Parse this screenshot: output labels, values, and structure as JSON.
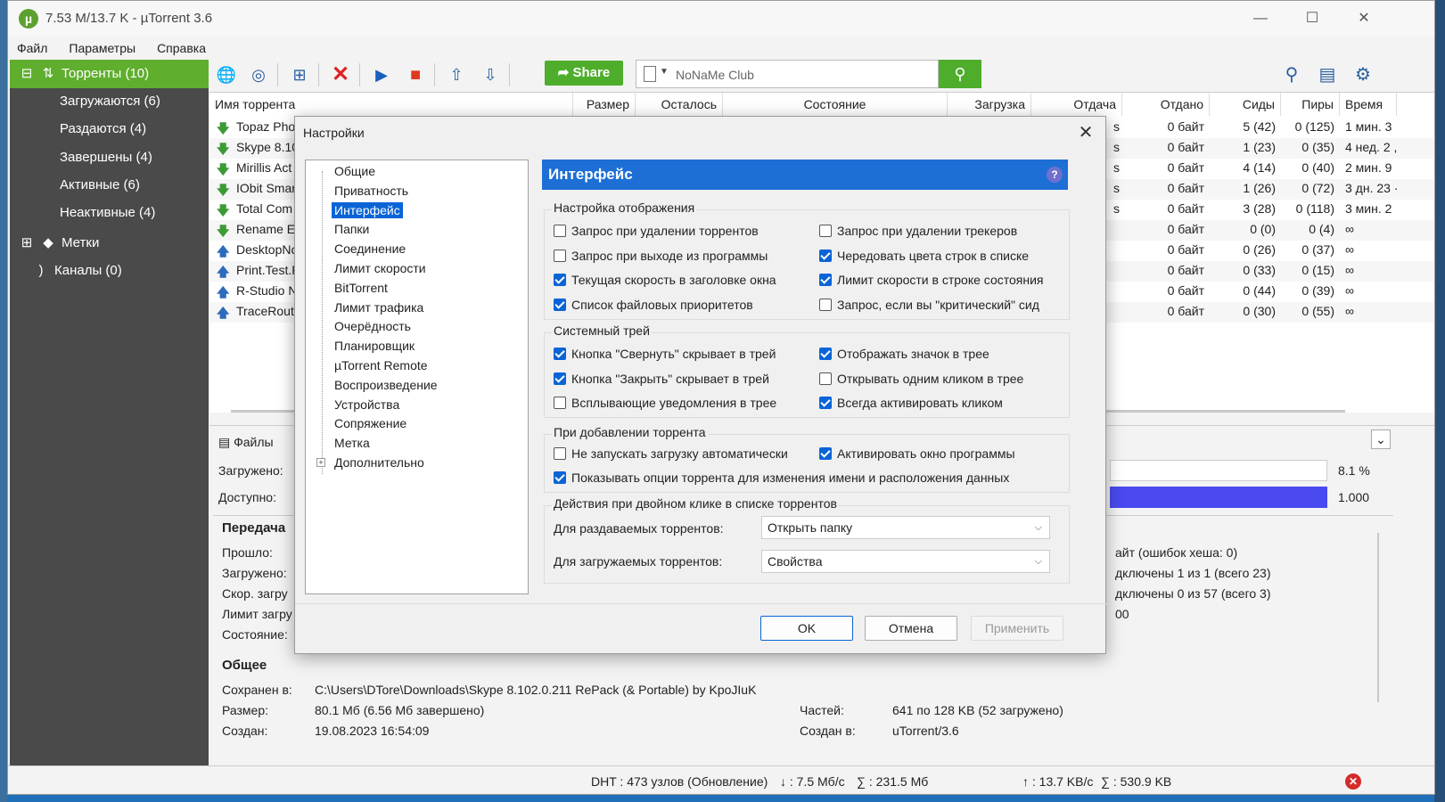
{
  "window": {
    "title": "7.53 M/13.7 K - µTorrent 3.6"
  },
  "menu": [
    "Файл",
    "Параметры",
    "Справка"
  ],
  "sidebar": {
    "torrents": "Торренты (10)",
    "downloading": "Загружаются (6)",
    "seeding": "Раздаются (4)",
    "completed": "Завершены (4)",
    "active": "Активные (6)",
    "inactive": "Неактивные (4)",
    "labels": "Метки",
    "feeds": "Каналы (0)"
  },
  "toolbar": {
    "share": "Share",
    "search_value": "NoNaMe Club"
  },
  "list": {
    "columns": {
      "name": "Имя торрента",
      "size": "Размер",
      "remaining": "Осталось",
      "status": "Состояние",
      "download": "Загрузка",
      "upload": "Отдача",
      "uploaded": "Отдано",
      "seeds": "Сиды",
      "peers": "Пиры",
      "time": "Время"
    },
    "rows": [
      {
        "name": "Topaz Phot",
        "uploaded": "0 байт",
        "seeds": "5 (42)",
        "peers": "0 (125)",
        "time": "1 мин. 3",
        "dir": "down",
        "tail": "s"
      },
      {
        "name": "Skype 8.10",
        "uploaded": "0 байт",
        "seeds": "1 (23)",
        "peers": "0 (35)",
        "time": "4 нед. 2 ,",
        "dir": "down",
        "tail": "s"
      },
      {
        "name": "Mirillis Act",
        "uploaded": "0 байт",
        "seeds": "4 (14)",
        "peers": "0 (40)",
        "time": "2 мин. 9",
        "dir": "down",
        "tail": "s"
      },
      {
        "name": "IObit Smar",
        "uploaded": "0 байт",
        "seeds": "1 (26)",
        "peers": "0 (72)",
        "time": "3 дн. 23 ·",
        "dir": "down",
        "tail": "s"
      },
      {
        "name": "Total Com",
        "uploaded": "0 байт",
        "seeds": "3 (28)",
        "peers": "0 (118)",
        "time": "3 мин. 2",
        "dir": "down",
        "tail": "s"
      },
      {
        "name": "Rename Ex",
        "uploaded": "0 байт",
        "seeds": "0 (0)",
        "peers": "0 (4)",
        "time": "∞",
        "dir": "down",
        "tail": ""
      },
      {
        "name": "DesktopNc",
        "uploaded": "0 байт",
        "seeds": "0 (26)",
        "peers": "0 (37)",
        "time": "∞",
        "dir": "up",
        "tail": ""
      },
      {
        "name": "Print.Test.P",
        "uploaded": "0 байт",
        "seeds": "0 (33)",
        "peers": "0 (15)",
        "time": "∞",
        "dir": "up",
        "tail": ""
      },
      {
        "name": "R-Studio N",
        "uploaded": "0 байт",
        "seeds": "0 (44)",
        "peers": "0 (39)",
        "time": "∞",
        "dir": "up",
        "tail": ""
      },
      {
        "name": "TraceRoute",
        "uploaded": "0 байт",
        "seeds": "0 (30)",
        "peers": "0 (55)",
        "time": "∞",
        "dir": "up",
        "tail": ""
      }
    ]
  },
  "details": {
    "files_tab": "Файлы",
    "downloaded_label": "Загружено:",
    "available_label": "Доступно:",
    "progress_pct": "8.1 %",
    "availability": "1.000",
    "transfer_title": "Передача",
    "elapsed_label": "Прошло:",
    "dl_label": "Загружено:",
    "speed_label": "Скор. загру",
    "limit_label": "Лимит загру",
    "state_label": "Состояние:",
    "right1": "айт (ошибок хеша: 0)",
    "right2": "дключены 1 из 1 (всего 23)",
    "right3": "дключены 0 из 57 (всего 3)",
    "right4": "00",
    "general_title": "Общее",
    "saved_label": "Сохранен в:",
    "saved_value": "C:\\Users\\DTore\\Downloads\\Skype 8.102.0.211 RePack (& Portable) by KpoJIuK",
    "size_label": "Размер:",
    "size_value": "80.1 Мб (6.56 Мб завершено)",
    "created_label": "Создан:",
    "created_value": "19.08.2023 16:54:09",
    "pieces_label": "Частей:",
    "pieces_value": "641 по 128 KB (52 загружено)",
    "createdby_label": "Создан в:",
    "createdby_value": "uTorrent/3.6"
  },
  "status": {
    "dht": "DHT : 473 узлов (Обновление)",
    "down": "↓ : 7.5 Мб/с",
    "down_total": "∑ : 231.5 Мб",
    "up": "↑ : 13.7 KB/c",
    "up_total": "∑ : 530.9 KB"
  },
  "dialog": {
    "title": "Настройки",
    "tree": [
      "Общие",
      "Приватность",
      "Интерфейс",
      "Папки",
      "Соединение",
      "Лимит скорости",
      "BitTorrent",
      "Лимит трафика",
      "Очерёдность",
      "Планировщик",
      "µTorrent Remote",
      "Воспроизведение",
      "Устройства",
      "Сопряжение",
      "Метка",
      "Дополнительно"
    ],
    "section": "Интерфейс",
    "g1": "Настройка отображения",
    "g1_items": [
      {
        "label": "Запрос при удалении торрентов",
        "on": false
      },
      {
        "label": "Запрос при удалении трекеров",
        "on": false
      },
      {
        "label": "Запрос при выходе из программы",
        "on": false
      },
      {
        "label": "Чередовать цвета строк в списке",
        "on": true
      },
      {
        "label": "Текущая скорость в заголовке окна",
        "on": true
      },
      {
        "label": "Лимит скорости в строке состояния",
        "on": true
      },
      {
        "label": "Список файловых приоритетов",
        "on": true
      },
      {
        "label": "Запрос, если вы \"критический\" сид",
        "on": false
      }
    ],
    "g2": "Системный трей",
    "g2_items": [
      {
        "label": "Кнопка \"Свернуть\" скрывает в трей",
        "on": true
      },
      {
        "label": "Отображать значок в трее",
        "on": true
      },
      {
        "label": "Кнопка \"Закрыть\" скрывает в трей",
        "on": true
      },
      {
        "label": "Открывать одним кликом в трее",
        "on": false
      },
      {
        "label": "Всплывающие уведомления в трее",
        "on": false
      },
      {
        "label": "Всегда активировать кликом",
        "on": true
      }
    ],
    "g3": "При добавлении торрента",
    "g3_items": [
      {
        "label": "Не запускать загрузку автоматически",
        "on": false
      },
      {
        "label": "Активировать окно программы",
        "on": true
      },
      {
        "label": "Показывать опции торрента для изменения имени и расположения данных",
        "on": true
      }
    ],
    "g4": "Действия при двойном клике в списке торрентов",
    "seed_label": "Для раздаваемых торрентов:",
    "seed_value": "Открыть папку",
    "dl_label": "Для загружаемых торрентов:",
    "dl_value": "Свойства",
    "ok": "OK",
    "cancel": "Отмена",
    "apply": "Применить"
  },
  "colors": {
    "accent_green": "#5fae2d",
    "selection_blue": "#0a64d6",
    "banner_blue": "#1d6fd6",
    "sidebar_bg": "#4a4a4a"
  }
}
